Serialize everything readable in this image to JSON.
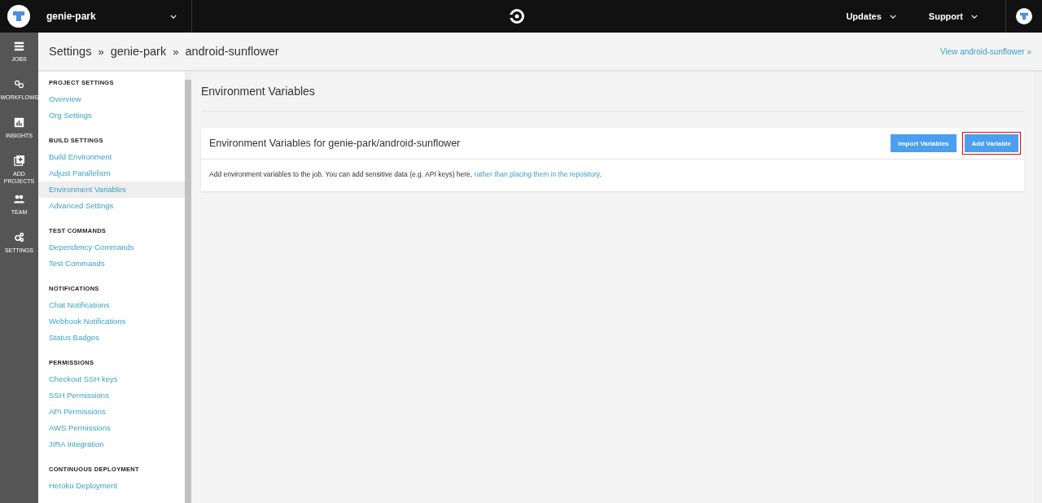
{
  "topbar": {
    "org": "genie-park",
    "menus": [
      "Updates",
      "Support"
    ]
  },
  "rail": [
    {
      "kind": "jobs",
      "label": "JOBS"
    },
    {
      "kind": "workflows",
      "label": "WORKFLOWS"
    },
    {
      "kind": "insights",
      "label": "INSIGHTS"
    },
    {
      "kind": "add",
      "label": "ADD PROJECTS"
    },
    {
      "kind": "team",
      "label": "TEAM"
    },
    {
      "kind": "settings",
      "label": "SETTINGS"
    }
  ],
  "breadcrumb": [
    "Settings",
    "»",
    "genie-park",
    "»",
    "android-sunflower"
  ],
  "view_link": "View android-sunflower »",
  "nav": [
    {
      "heading": "PROJECT SETTINGS",
      "items": [
        {
          "label": "Overview",
          "selected": false
        },
        {
          "label": "Org Settings",
          "selected": false
        }
      ]
    },
    {
      "heading": "BUILD SETTINGS",
      "items": [
        {
          "label": "Build Environment",
          "selected": false
        },
        {
          "label": "Adjust Parallelism",
          "selected": false
        },
        {
          "label": "Environment Variables",
          "selected": true
        },
        {
          "label": "Advanced Settings",
          "selected": false
        }
      ]
    },
    {
      "heading": "TEST COMMANDS",
      "items": [
        {
          "label": "Dependency Commands",
          "selected": false
        },
        {
          "label": "Test Commands",
          "selected": false
        }
      ]
    },
    {
      "heading": "NOTIFICATIONS",
      "items": [
        {
          "label": "Chat Notifications",
          "selected": false
        },
        {
          "label": "Webhook Notifications",
          "selected": false
        },
        {
          "label": "Status Badges",
          "selected": false
        }
      ]
    },
    {
      "heading": "PERMISSIONS",
      "items": [
        {
          "label": "Checkout SSH keys",
          "selected": false
        },
        {
          "label": "SSH Permissions",
          "selected": false
        },
        {
          "label": "API Permissions",
          "selected": false
        },
        {
          "label": "AWS Permissions",
          "selected": false
        },
        {
          "label": "JIRA Integration",
          "selected": false
        }
      ]
    },
    {
      "heading": "CONTINUOUS DEPLOYMENT",
      "items": [
        {
          "label": "Heroku Deployment",
          "selected": false
        }
      ]
    }
  ],
  "page_title": "Environment Variables",
  "card": {
    "title": "Environment Variables for genie-park/android-sunflower",
    "buttons": [
      {
        "label": "Import Variables",
        "highlighted": false
      },
      {
        "label": "Add Variable",
        "highlighted": true
      }
    ],
    "text": "Add environment variables to the job. You can add sensitive data (e.g. API keys) here, ",
    "link": "rather than placing them in the repository",
    "tail": "."
  }
}
